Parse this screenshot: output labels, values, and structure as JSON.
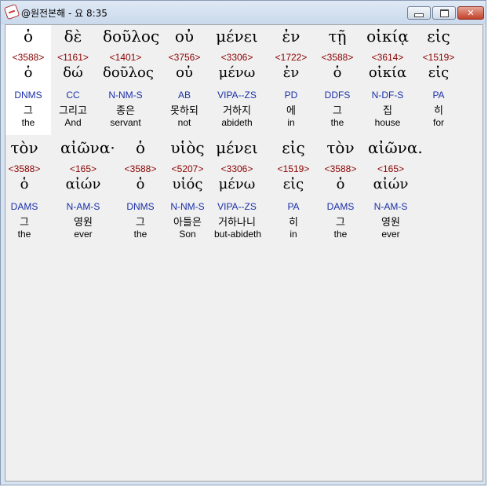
{
  "window": {
    "title": "@원전본해 - 요 8:35",
    "minimize_glyph": "",
    "maximize_glyph": "",
    "close_glyph": "✕"
  },
  "lines": [
    {
      "words": [
        {
          "greek": "ὁ",
          "strong": "<3588>",
          "lemma": "ὁ",
          "parse": "DNMS",
          "korean": "그",
          "english": "the"
        },
        {
          "greek": "δὲ",
          "strong": "<1161>",
          "lemma": "δώ",
          "parse": "CC",
          "korean": "그리고",
          "english": "And"
        },
        {
          "greek": "δοῦλος",
          "strong": "<1401>",
          "lemma": "δοῦλος",
          "parse": "N-NM-S",
          "korean": "종은",
          "english": "servant"
        },
        {
          "greek": "οὐ",
          "strong": "<3756>",
          "lemma": "οὐ",
          "parse": "AB",
          "korean": "못하되",
          "english": "not"
        },
        {
          "greek": "μένει",
          "strong": "<3306>",
          "lemma": "μένω",
          "parse": "VIPA--ZS",
          "korean": "거하지",
          "english": "abideth"
        },
        {
          "greek": "ἐν",
          "strong": "<1722>",
          "lemma": "ἐν",
          "parse": "PD",
          "korean": "에",
          "english": "in"
        },
        {
          "greek": "τῇ",
          "strong": "<3588>",
          "lemma": "ὁ",
          "parse": "DDFS",
          "korean": "그",
          "english": "the"
        },
        {
          "greek": "οἰκίᾳ",
          "strong": "<3614>",
          "lemma": "οἰκία",
          "parse": "N-DF-S",
          "korean": "집",
          "english": "house"
        },
        {
          "greek": "εἰς",
          "strong": "<1519>",
          "lemma": "εἰς",
          "parse": "PA",
          "korean": "히",
          "english": "for"
        }
      ]
    },
    {
      "words": [
        {
          "greek": "τὸν",
          "strong": "<3588>",
          "lemma": "ὁ",
          "parse": "DAMS",
          "korean": "그",
          "english": "the"
        },
        {
          "greek": "αἰῶνα·",
          "strong": "<165>",
          "lemma": "αἰών",
          "parse": "N-AM-S",
          "korean": "영원",
          "english": "ever"
        },
        {
          "greek": "ὁ",
          "strong": "<3588>",
          "lemma": "ὁ",
          "parse": "DNMS",
          "korean": "그",
          "english": "the"
        },
        {
          "greek": "υἱὸς",
          "strong": "<5207>",
          "lemma": "υἱός",
          "parse": "N-NM-S",
          "korean": "아들은",
          "english": "Son"
        },
        {
          "greek": "μένει",
          "strong": "<3306>",
          "lemma": "μένω",
          "parse": "VIPA--ZS",
          "korean": "거하나니",
          "english": "but-abideth"
        },
        {
          "greek": "εἰς",
          "strong": "<1519>",
          "lemma": "εἰς",
          "parse": "PA",
          "korean": "히",
          "english": "in"
        },
        {
          "greek": "τὸν",
          "strong": "<3588>",
          "lemma": "ὁ",
          "parse": "DAMS",
          "korean": "그",
          "english": "the"
        },
        {
          "greek": "αἰῶνα.",
          "strong": "<165>",
          "lemma": "αἰών",
          "parse": "N-AM-S",
          "korean": "영원",
          "english": "ever"
        }
      ]
    }
  ]
}
